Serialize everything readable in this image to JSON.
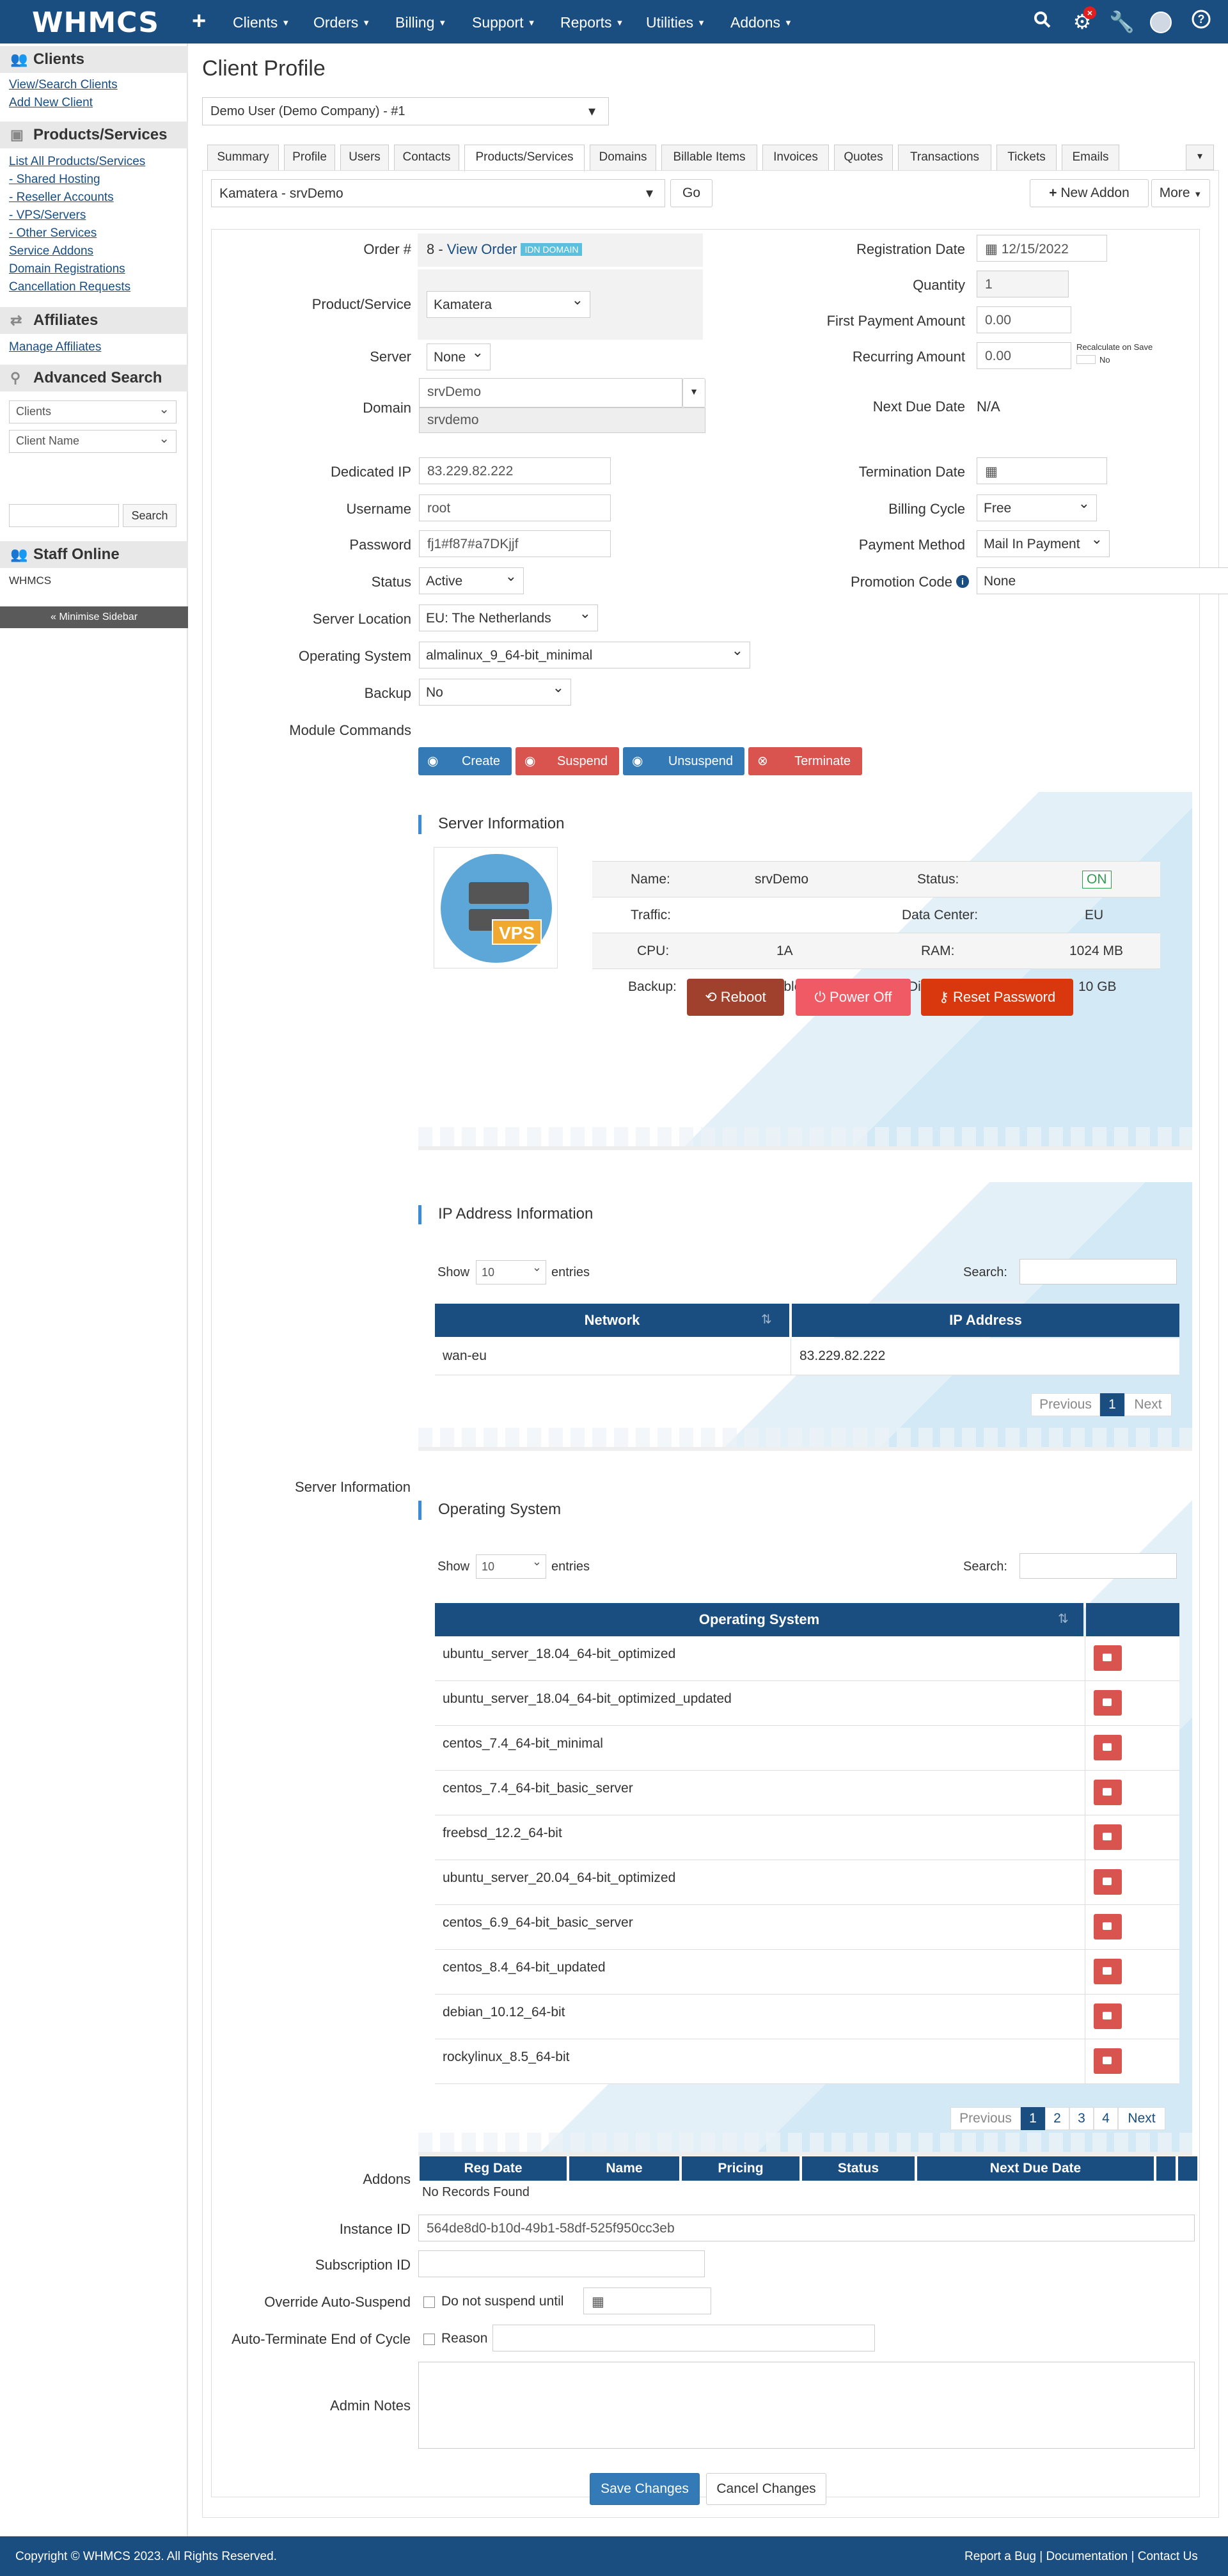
{
  "brand": "WHMCS",
  "nav": {
    "items": [
      "Clients",
      "Orders",
      "Billing",
      "Support",
      "Reports",
      "Utilities",
      "Addons"
    ],
    "icons": [
      "search-icon",
      "gear-icon",
      "wrench-icon",
      "user-icon",
      "help-icon"
    ],
    "alert_badge": "×"
  },
  "sidebar": {
    "clients_head": "Clients",
    "clients_links": [
      "View/Search Clients",
      "Add New Client"
    ],
    "products_head": "Products/Services",
    "products_links": [
      "List All Products/Services",
      "- Shared Hosting",
      "- Reseller Accounts",
      "- VPS/Servers",
      "- Other Services",
      "Service Addons",
      "Domain Registrations",
      "Cancellation Requests"
    ],
    "affiliates_head": "Affiliates",
    "affiliates_links": [
      "Manage Affiliates"
    ],
    "search_head": "Advanced Search",
    "search_type": "Clients",
    "search_field": "Client Name",
    "search_btn": "Search",
    "staff_head": "Staff Online",
    "staff_name": "WHMCS",
    "minimise": "« Minimise Sidebar"
  },
  "page": {
    "title": "Client Profile",
    "client_select": "Demo User (Demo Company) - #1",
    "tabs": [
      "Summary",
      "Profile",
      "Users",
      "Contacts",
      "Products/Services",
      "Domains",
      "Billable Items",
      "Invoices",
      "Quotes",
      "Transactions",
      "Tickets",
      "Emails"
    ],
    "tab_dropdown": "▾",
    "product_select": "Kamatera - srvDemo",
    "go_btn": "Go",
    "new_addon_btn": "New Addon",
    "more_btn": "More"
  },
  "form": {
    "order_label": "Order #",
    "order_value": "8 - ",
    "view_order": "View Order",
    "idn_badge": "IDN DOMAIN",
    "product_label": "Product/Service",
    "product_value": "Kamatera",
    "server_label": "Server",
    "server_value": "None",
    "domain_label": "Domain",
    "domain_value": "srvDemo",
    "domain_suggest": "srvdemo",
    "ip_label": "Dedicated IP",
    "ip_value": "83.229.82.222",
    "username_label": "Username",
    "username_value": "root",
    "password_label": "Password",
    "password_value": "fj1#f87#a7DKjjf",
    "status_label": "Status",
    "status_value": "Active",
    "regdate_label": "Registration Date",
    "regdate_value": "12/15/2022",
    "qty_label": "Quantity",
    "qty_value": "1",
    "first_pay_label": "First Payment Amount",
    "first_pay_value": "0.00",
    "recurring_label": "Recurring Amount",
    "recurring_value": "0.00",
    "recalc_label": "Recalculate on Save",
    "recalc_value": "No",
    "due_label": "Next Due Date",
    "due_value": "N/A",
    "term_label": "Termination Date",
    "cycle_label": "Billing Cycle",
    "cycle_value": "Free",
    "paymethod_label": "Payment Method",
    "paymethod_value": "Mail In Payment",
    "promo_label": "Promotion Code",
    "promo_value": "None",
    "location_label": "Server Location",
    "location_value": "EU: The Netherlands",
    "os_label": "Operating System",
    "os_value": "almalinux_9_64-bit_minimal",
    "backup_label": "Backup",
    "backup_value": "No",
    "module_label": "Module Commands",
    "module_btns": [
      "Create",
      "Suspend",
      "Unsuspend",
      "Terminate"
    ],
    "server_info_label": "Server Information",
    "addons_label": "Addons",
    "instance_label": "Instance ID",
    "instance_value": "564de8d0-b10d-49b1-58df-525f950cc3eb",
    "subscription_label": "Subscription ID",
    "override_label": "Override Auto-Suspend",
    "override_text": "Do not suspend until",
    "autoterm_label": "Auto-Terminate End of Cycle",
    "reason_text": "Reason",
    "notes_label": "Admin Notes"
  },
  "server_panel": {
    "title": "Server Information",
    "vps_tag": "VPS",
    "rows": [
      {
        "k1": "Name:",
        "v1": "srvDemo",
        "k2": "Status:",
        "v2": "ON"
      },
      {
        "k1": "Traffic:",
        "v1": "",
        "k2": "Data Center:",
        "v2": "EU"
      },
      {
        "k1": "CPU:",
        "v1": "1A",
        "k2": "RAM:",
        "v2": "1024 MB"
      },
      {
        "k1": "Backup:",
        "v1": "Enabled",
        "k2": "Disk Size:",
        "v2": "10 GB"
      }
    ],
    "buttons": [
      "Reboot",
      "Power Off",
      "Reset Password"
    ],
    "colors": {
      "reboot": "#a0412d",
      "power": "#f05a65",
      "reset": "#d9380f"
    }
  },
  "ip_panel": {
    "title": "IP Address Information",
    "show": "Show",
    "entries_value": "10",
    "entries": "entries",
    "search": "Search:",
    "headers": [
      "Network",
      "IP Address"
    ],
    "rows": [
      [
        "wan-eu",
        "83.229.82.222"
      ]
    ],
    "pager": [
      "Previous",
      "1",
      "Next"
    ]
  },
  "os_panel": {
    "title": "Operating System",
    "show": "Show",
    "entries_value": "10",
    "entries": "entries",
    "search": "Search:",
    "header": "Operating System",
    "rows": [
      "ubuntu_server_18.04_64-bit_optimized",
      "ubuntu_server_18.04_64-bit_optimized_updated",
      "centos_7.4_64-bit_minimal",
      "centos_7.4_64-bit_basic_server",
      "freebsd_12.2_64-bit",
      "ubuntu_server_20.04_64-bit_optimized",
      "centos_6.9_64-bit_basic_server",
      "centos_8.4_64-bit_updated",
      "debian_10.12_64-bit",
      "rockylinux_8.5_64-bit"
    ],
    "pager": [
      "Previous",
      "1",
      "2",
      "3",
      "4",
      "Next"
    ]
  },
  "addons_table": {
    "headers": [
      "Reg Date",
      "Name",
      "Pricing",
      "Status",
      "Next Due Date"
    ],
    "empty": "No Records Found"
  },
  "actions": {
    "save": "Save Changes",
    "cancel": "Cancel Changes"
  },
  "footer": {
    "copyright": "Copyright © WHMCS 2023. All Rights Reserved.",
    "links": "Report a Bug | Documentation | Contact Us"
  }
}
